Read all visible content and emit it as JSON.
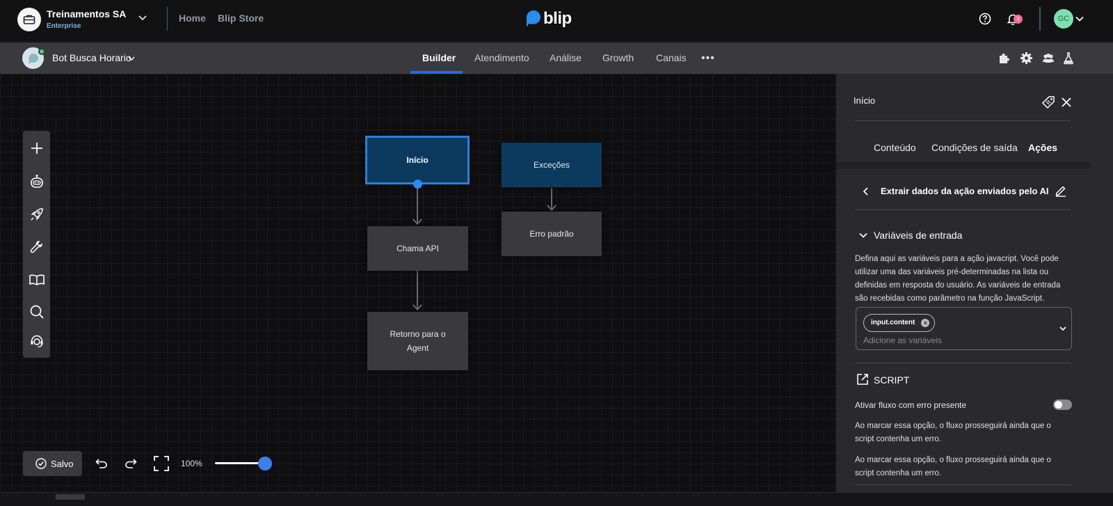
{
  "topbar": {
    "org_name": "Treinamentos SA",
    "org_plan": "Enterprise",
    "nav": [
      "Home",
      "Blip Store"
    ],
    "logo_text": "blip",
    "notification_count": "3",
    "user_initials": "GC",
    "accent_color": "#1e6bf1"
  },
  "subbar": {
    "bot_name": "Bot Busca Horario",
    "tabs": [
      "Builder",
      "Atendimento",
      "Análise",
      "Growth",
      "Canais"
    ],
    "active_tab": "Builder",
    "icons": [
      "puzzle-icon",
      "gear-icon",
      "team-icon",
      "flask-icon"
    ]
  },
  "canvas": {
    "toolbar_icons": [
      "plus-icon",
      "bot-icon",
      "rocket-icon",
      "wrench-icon",
      "book-icon",
      "search-icon",
      "support-icon"
    ],
    "blocks": [
      {
        "id": "inicio",
        "label": "Início",
        "style": "blue",
        "selected": true
      },
      {
        "id": "excecoes",
        "label": "Exceções",
        "style": "blue"
      },
      {
        "id": "chama-api",
        "label": "Chama API",
        "style": "grey"
      },
      {
        "id": "erro-padrao",
        "label": "Erro padrão",
        "style": "grey"
      },
      {
        "id": "retorno-agent",
        "label": "Retorno para o Agent",
        "style": "grey"
      }
    ],
    "save_label": "Salvo",
    "zoom_label": "100%",
    "zoom_level": 1.0
  },
  "panel": {
    "title": "Início",
    "tabs": [
      "Conteúdo",
      "Condições de saída",
      "Ações"
    ],
    "active_tab": "Ações",
    "action_title": "Extrair dados da ação enviados pelo AI",
    "section_title": "Variáveis de entrada",
    "section_desc": "Defina aqui as variáveis para a ação javacript. Você pode utilizar uma das variáveis pré-determinadas na lista ou definidas em resposta do usuário. As variáveis de entrada são recebidas como parâmetro na função JavaScript.",
    "variable_chip": "input.content",
    "variables_placeholder": "Adicione as variáveis",
    "script_label": "SCRIPT",
    "toggle_label": "Ativar fluxo com erro presente",
    "toggle_on": false,
    "toggle_desc_1": "Ao marcar essa opção, o fluxo prosseguirá ainda que o script contenha um erro.",
    "toggle_desc_2": "Ao marcar essa opção, o fluxo prosseguirá ainda que o script contenha um erro."
  }
}
